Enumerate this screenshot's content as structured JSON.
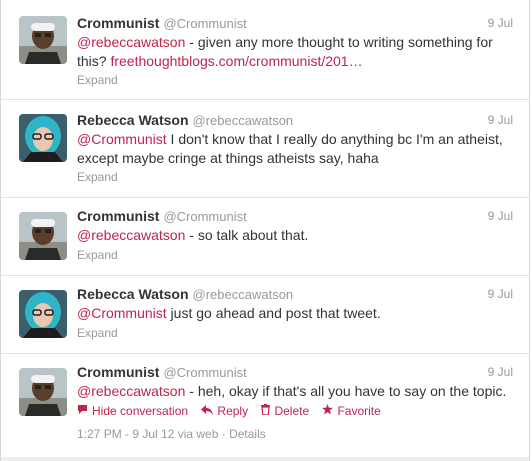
{
  "tweets": [
    {
      "fullname": "Crommunist",
      "username": "@Crommunist",
      "time": "9 Jul",
      "mention": "@rebeccawatson",
      "text": " - given any more thought to writing something for this? ",
      "link": "freethoughtblogs.com/crommunist/201…",
      "expand": "Expand"
    },
    {
      "fullname": "Rebecca Watson",
      "username": "@rebeccawatson",
      "time": "9 Jul",
      "mention": "@Crommunist",
      "text": " I don't know that I really do anything bc I'm an atheist, except maybe cringe at things atheists say, haha",
      "expand": "Expand"
    },
    {
      "fullname": "Crommunist",
      "username": "@Crommunist",
      "time": "9 Jul",
      "mention": "@rebeccawatson",
      "text": " - so talk about that.",
      "expand": "Expand"
    },
    {
      "fullname": "Rebecca Watson",
      "username": "@rebeccawatson",
      "time": "9 Jul",
      "mention": "@Crommunist",
      "text": " just go ahead and post that tweet.",
      "expand": "Expand"
    },
    {
      "fullname": "Crommunist",
      "username": "@Crommunist",
      "time": "9 Jul",
      "mention": "@rebeccawatson",
      "text": " - heh, okay if that's all you have to say on the topic.",
      "actions": {
        "hide_conversation": "Hide conversation",
        "reply": "Reply",
        "delete": "Delete",
        "favorite": "Favorite"
      },
      "meta": "1:27 PM - 9 Jul 12 via web · Details"
    }
  ],
  "icons": {
    "hide_conversation": "speech-bubble-icon",
    "reply": "reply-arrow-icon",
    "delete": "trash-icon",
    "favorite": "star-icon"
  },
  "colors": {
    "accent": "#c0244c",
    "muted": "#999999",
    "text": "#333333",
    "divider": "#e3e3e3",
    "rebecca_hair": "#2fb5c8"
  }
}
